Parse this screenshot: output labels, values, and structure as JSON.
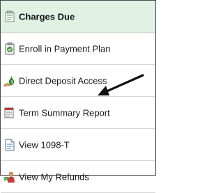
{
  "menu": {
    "items": [
      {
        "label": "Charges Due",
        "icon": "charges-due-icon",
        "active": true
      },
      {
        "label": "Enroll in Payment Plan",
        "icon": "payment-plan-clipboard-icon",
        "active": false
      },
      {
        "label": "Direct Deposit Access",
        "icon": "money-bag-hand-icon",
        "active": false
      },
      {
        "label": "Term Summary Report",
        "icon": "report-icon",
        "active": false
      },
      {
        "label": "View 1098-T",
        "icon": "tax-form-icon",
        "active": false
      },
      {
        "label": "View My Refunds",
        "icon": "refund-person-icon",
        "active": false
      }
    ]
  },
  "annotation": {
    "type": "arrow",
    "points_to": "Term Summary Report",
    "color": "#111111"
  },
  "colors": {
    "active_bg": "#dff2e4",
    "divider": "#d6d6d6",
    "text": "#1a1a1a"
  }
}
